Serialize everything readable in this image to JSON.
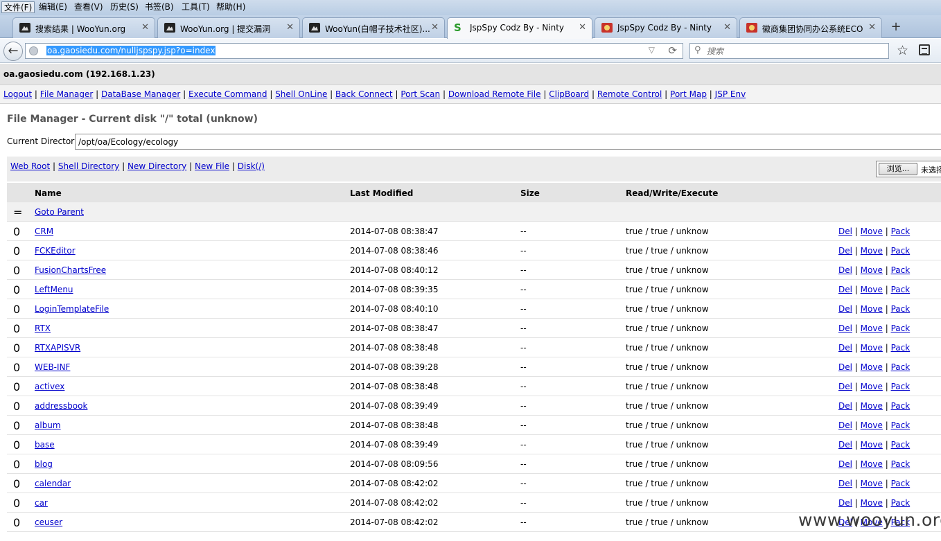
{
  "menu": [
    "文件(F)",
    "编辑(E)",
    "查看(V)",
    "历史(S)",
    "书签(B)",
    "工具(T)",
    "帮助(H)"
  ],
  "tabs": [
    {
      "title": "搜索结果 | WooYun.org",
      "icon": "wooyun-icon"
    },
    {
      "title": "WooYun.org | 提交漏洞",
      "icon": "wooyun-icon"
    },
    {
      "title": "WooYun(白帽子技术社区)...",
      "icon": "wooyun-icon"
    },
    {
      "title": "JspSpy Codz By - Ninty",
      "icon": "jspspy-icon"
    },
    {
      "title": "JspSpy Codz By - Ninty",
      "icon": "red-seal-icon"
    },
    {
      "title": "徽商集团协同办公系统ECO",
      "icon": "red-seal-icon"
    }
  ],
  "newtab": "+",
  "nav": {
    "url": "oa.gaosiedu.com/nulljspspy.jsp?o=index",
    "search_placeholder": "搜索"
  },
  "host": "oa.gaosiedu.com (192.168.1.23)",
  "top_links": [
    "Logout",
    "File Manager",
    "DataBase Manager",
    "Execute Command",
    "Shell OnLine",
    "Back Connect",
    "Port Scan",
    "Download Remote File",
    "ClipBoard",
    "Remote Control",
    "Port Map",
    "JSP Env"
  ],
  "fm_title": "File Manager - Current disk \"/\" total (unknow)",
  "current_dir_label": "Current Directory",
  "current_dir": "/opt/oa/Ecology/ecology",
  "tool_links": [
    "Web Root",
    "Shell Directory",
    "New Directory",
    "New File",
    "Disk(/)"
  ],
  "browse_label": "浏览...",
  "no_file_label": "未选择",
  "headers": {
    "name": "Name",
    "modified": "Last Modified",
    "size": "Size",
    "rwx": "Read/Write/Execute"
  },
  "parent": {
    "mark": "=",
    "label": "Goto Parent"
  },
  "actions": [
    "Del",
    "Move",
    "Pack"
  ],
  "rows": [
    {
      "mark": "0",
      "name": "CRM",
      "modified": "2014-07-08 08:38:47",
      "size": "--",
      "rwx": "true / true / unknow"
    },
    {
      "mark": "0",
      "name": "FCKEditor",
      "modified": "2014-07-08 08:38:46",
      "size": "--",
      "rwx": "true / true / unknow"
    },
    {
      "mark": "0",
      "name": "FusionChartsFree",
      "modified": "2014-07-08 08:40:12",
      "size": "--",
      "rwx": "true / true / unknow"
    },
    {
      "mark": "0",
      "name": "LeftMenu",
      "modified": "2014-07-08 08:39:35",
      "size": "--",
      "rwx": "true / true / unknow"
    },
    {
      "mark": "0",
      "name": "LoginTemplateFile",
      "modified": "2014-07-08 08:40:10",
      "size": "--",
      "rwx": "true / true / unknow"
    },
    {
      "mark": "0",
      "name": "RTX",
      "modified": "2014-07-08 08:38:47",
      "size": "--",
      "rwx": "true / true / unknow"
    },
    {
      "mark": "0",
      "name": "RTXAPISVR",
      "modified": "2014-07-08 08:38:48",
      "size": "--",
      "rwx": "true / true / unknow"
    },
    {
      "mark": "0",
      "name": "WEB-INF",
      "modified": "2014-07-08 08:39:28",
      "size": "--",
      "rwx": "true / true / unknow"
    },
    {
      "mark": "0",
      "name": "activex",
      "modified": "2014-07-08 08:38:48",
      "size": "--",
      "rwx": "true / true / unknow"
    },
    {
      "mark": "0",
      "name": "addressbook",
      "modified": "2014-07-08 08:39:49",
      "size": "--",
      "rwx": "true / true / unknow"
    },
    {
      "mark": "0",
      "name": "album",
      "modified": "2014-07-08 08:38:48",
      "size": "--",
      "rwx": "true / true / unknow"
    },
    {
      "mark": "0",
      "name": "base",
      "modified": "2014-07-08 08:39:49",
      "size": "--",
      "rwx": "true / true / unknow"
    },
    {
      "mark": "0",
      "name": "blog",
      "modified": "2014-07-08 08:09:56",
      "size": "--",
      "rwx": "true / true / unknow"
    },
    {
      "mark": "0",
      "name": "calendar",
      "modified": "2014-07-08 08:42:02",
      "size": "--",
      "rwx": "true / true / unknow"
    },
    {
      "mark": "0",
      "name": "car",
      "modified": "2014-07-08 08:42:02",
      "size": "--",
      "rwx": "true / true / unknow"
    },
    {
      "mark": "0",
      "name": "ceuser",
      "modified": "2014-07-08 08:42:02",
      "size": "--",
      "rwx": "true / true / unknow"
    }
  ],
  "watermark": "www.wooyun.org"
}
